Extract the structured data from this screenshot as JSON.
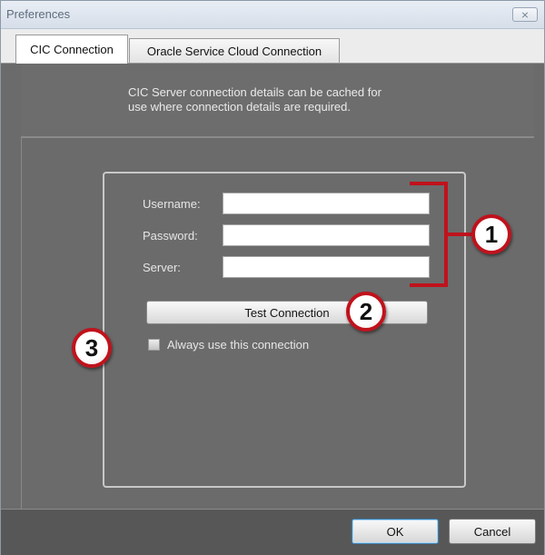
{
  "window": {
    "title": "Preferences",
    "close_glyph": "⨯",
    "close_icon": "close-icon"
  },
  "tabs": [
    {
      "label": "CIC Connection",
      "active": true
    },
    {
      "label": "Oracle Service Cloud Connection",
      "active": false
    }
  ],
  "info": {
    "line1": "CIC Server connection details can be cached for",
    "line2": "use where connection details are required."
  },
  "form": {
    "username_label": "Username:",
    "password_label": "Password:",
    "server_label": "Server:",
    "username_value": "",
    "password_value": "",
    "server_value": "",
    "test_button_label": "Test Connection",
    "always_use_label": "Always use this connection",
    "always_use_checked": false
  },
  "callouts": {
    "one": "1",
    "two": "2",
    "three": "3"
  },
  "footer": {
    "ok_label": "OK",
    "cancel_label": "Cancel"
  },
  "colors": {
    "callout_red": "#c0121c",
    "panel_gray": "#6b6b6b"
  }
}
